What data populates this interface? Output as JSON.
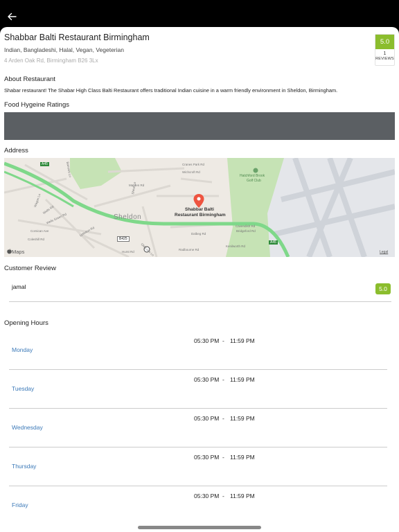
{
  "header": {
    "back_icon": "arrow-left-icon"
  },
  "restaurant": {
    "name": "Shabbar Balti Restaurant Birmingham",
    "cuisines": "Indian, Bangladeshi, Halal, Vegan, Vegeterian",
    "address": "4 Arden Oak Rd, Birmingham B26 3Lx",
    "rating": "5.0",
    "review_count": "1",
    "review_label": "REVIEWS"
  },
  "about": {
    "heading": "About Restaurant",
    "text": "Shabar restaurant! The Shabar High Class Balti Restaurant offers traditional Indian cuisine in a warm friendly environment in Sheldon, Birmingham."
  },
  "hygiene": {
    "heading": "Food Hygeine Ratings"
  },
  "address_section": {
    "heading": "Address",
    "map": {
      "pin_label_line1": "Shabbar Balti",
      "pin_label_line2": "Restaurant Birmingham",
      "area_name": "Sheldon",
      "golf_label_line1": "Hatchford Brook",
      "golf_label_line2": "Golf Club",
      "attribution": "Maps",
      "legal": "Legal",
      "road_a45_left": "A45",
      "road_b425": "B425",
      "road_a45_right": "A45",
      "streets": [
        "Cranes Park Rd",
        "Wichcroft Rd",
        "Marden Rd",
        "Barrows Ln",
        "Sheaf Ln",
        "Wagon Ln",
        "Wells Rd",
        "Wells Green Rd",
        "Corsican Ave",
        "Coleshill Rd",
        "Old Lode Ln",
        "Hurst Rd",
        "Radbourne Rd",
        "Bridgeford Rd",
        "Dalbeg Rd",
        "Kenilworth Rd",
        "Lyttelton Rd",
        "Cavendish Rd"
      ]
    }
  },
  "reviews": {
    "heading": "Customer Review",
    "items": [
      {
        "name": "jamal",
        "score": "5.0"
      }
    ]
  },
  "hours": {
    "heading": "Opening Hours",
    "separator": "-",
    "days": [
      {
        "day": "Monday",
        "open": "05:30 PM",
        "close": "11:59 PM"
      },
      {
        "day": "Tuesday",
        "open": "05:30 PM",
        "close": "11:59 PM"
      },
      {
        "day": "Wednesday",
        "open": "05:30 PM",
        "close": "11:59 PM"
      },
      {
        "day": "Thursday",
        "open": "05:30 PM",
        "close": "11:59 PM"
      },
      {
        "day": "Friday",
        "open": "05:30 PM",
        "close": "11:59 PM"
      }
    ]
  },
  "colors": {
    "rating_green": "#8bbd2d",
    "day_blue": "#3b79b8",
    "hygiene_gray": "#5b5f63",
    "pin_red": "#ee5440"
  }
}
